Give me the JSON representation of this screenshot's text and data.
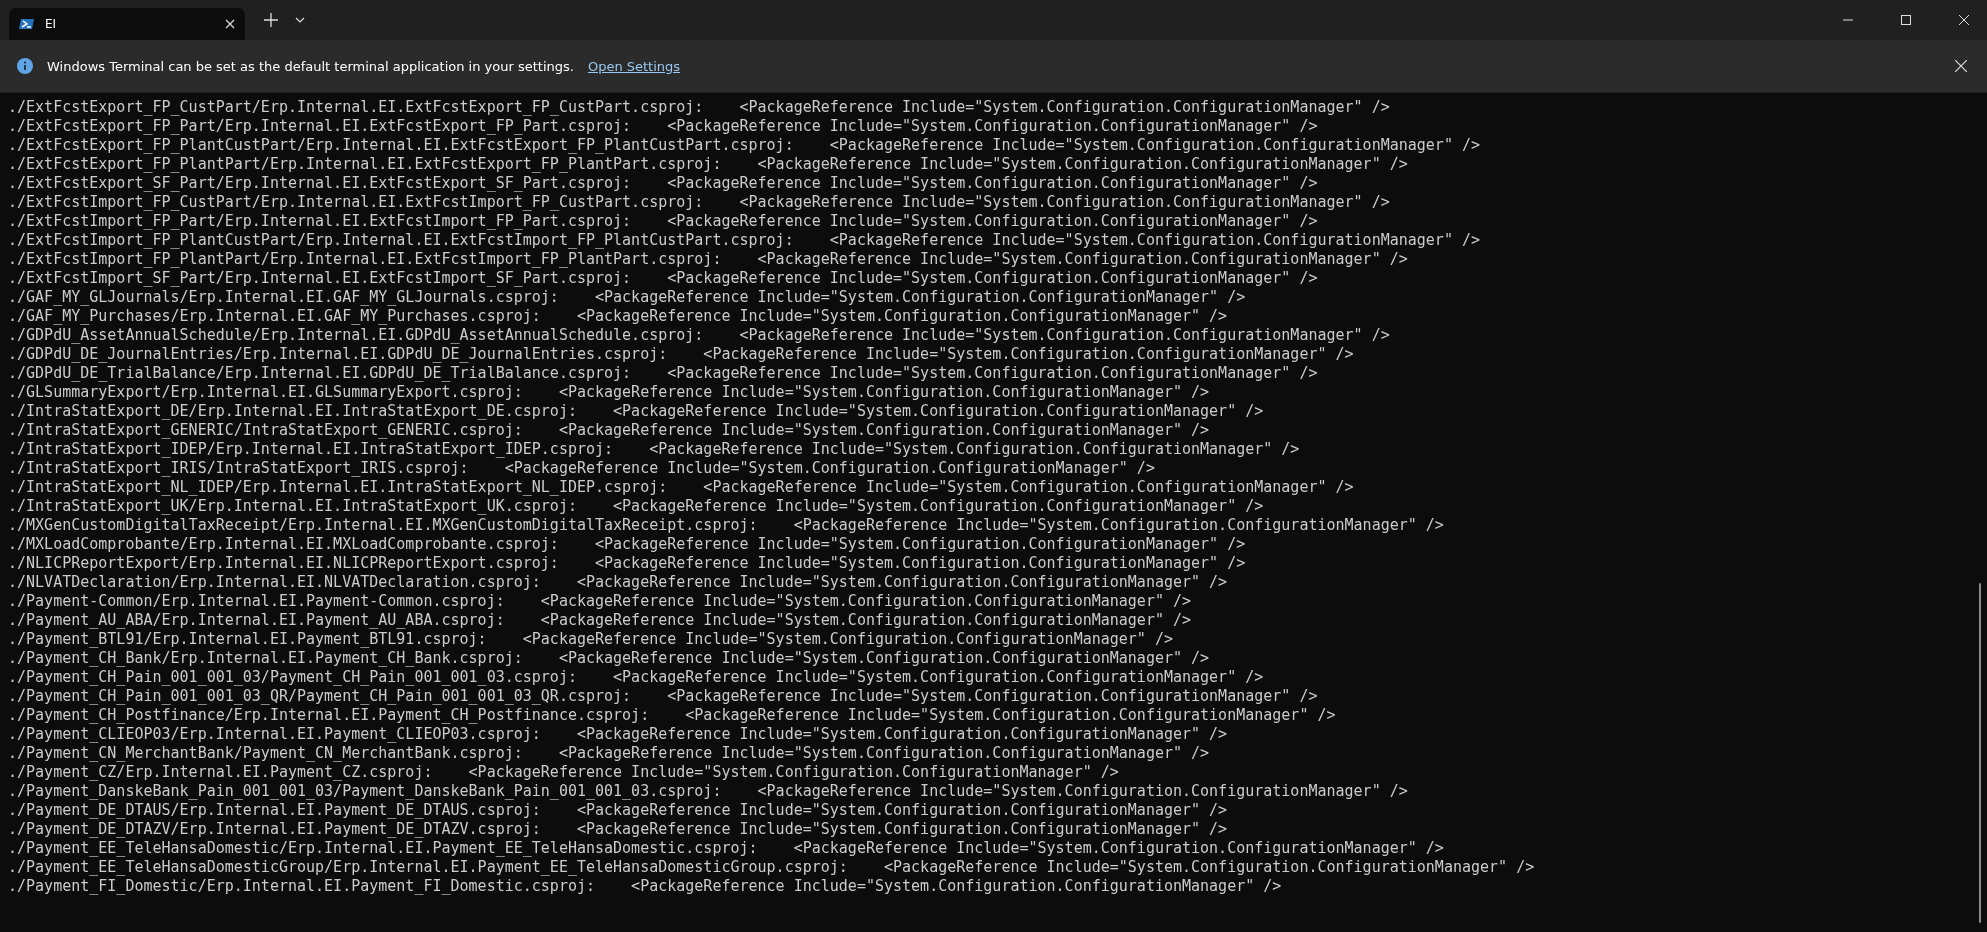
{
  "tab": {
    "title": "EI"
  },
  "infobar": {
    "message": "Windows Terminal can be set as the default terminal application in your settings.",
    "link": "Open Settings"
  },
  "terminal": {
    "lines": [
      "./ExtFcstExport_FP_CustPart/Erp.Internal.EI.ExtFcstExport_FP_CustPart.csproj:    <PackageReference Include=\"System.Configuration.ConfigurationManager\" />",
      "./ExtFcstExport_FP_Part/Erp.Internal.EI.ExtFcstExport_FP_Part.csproj:    <PackageReference Include=\"System.Configuration.ConfigurationManager\" />",
      "./ExtFcstExport_FP_PlantCustPart/Erp.Internal.EI.ExtFcstExport_FP_PlantCustPart.csproj:    <PackageReference Include=\"System.Configuration.ConfigurationManager\" />",
      "./ExtFcstExport_FP_PlantPart/Erp.Internal.EI.ExtFcstExport_FP_PlantPart.csproj:    <PackageReference Include=\"System.Configuration.ConfigurationManager\" />",
      "./ExtFcstExport_SF_Part/Erp.Internal.EI.ExtFcstExport_SF_Part.csproj:    <PackageReference Include=\"System.Configuration.ConfigurationManager\" />",
      "./ExtFcstImport_FP_CustPart/Erp.Internal.EI.ExtFcstImport_FP_CustPart.csproj:    <PackageReference Include=\"System.Configuration.ConfigurationManager\" />",
      "./ExtFcstImport_FP_Part/Erp.Internal.EI.ExtFcstImport_FP_Part.csproj:    <PackageReference Include=\"System.Configuration.ConfigurationManager\" />",
      "./ExtFcstImport_FP_PlantCustPart/Erp.Internal.EI.ExtFcstImport_FP_PlantCustPart.csproj:    <PackageReference Include=\"System.Configuration.ConfigurationManager\" />",
      "./ExtFcstImport_FP_PlantPart/Erp.Internal.EI.ExtFcstImport_FP_PlantPart.csproj:    <PackageReference Include=\"System.Configuration.ConfigurationManager\" />",
      "./ExtFcstImport_SF_Part/Erp.Internal.EI.ExtFcstImport_SF_Part.csproj:    <PackageReference Include=\"System.Configuration.ConfigurationManager\" />",
      "./GAF_MY_GLJournals/Erp.Internal.EI.GAF_MY_GLJournals.csproj:    <PackageReference Include=\"System.Configuration.ConfigurationManager\" />",
      "./GAF_MY_Purchases/Erp.Internal.EI.GAF_MY_Purchases.csproj:    <PackageReference Include=\"System.Configuration.ConfigurationManager\" />",
      "./GDPdU_AssetAnnualSchedule/Erp.Internal.EI.GDPdU_AssetAnnualSchedule.csproj:    <PackageReference Include=\"System.Configuration.ConfigurationManager\" />",
      "./GDPdU_DE_JournalEntries/Erp.Internal.EI.GDPdU_DE_JournalEntries.csproj:    <PackageReference Include=\"System.Configuration.ConfigurationManager\" />",
      "./GDPdU_DE_TrialBalance/Erp.Internal.EI.GDPdU_DE_TrialBalance.csproj:    <PackageReference Include=\"System.Configuration.ConfigurationManager\" />",
      "./GLSummaryExport/Erp.Internal.EI.GLSummaryExport.csproj:    <PackageReference Include=\"System.Configuration.ConfigurationManager\" />",
      "./IntraStatExport_DE/Erp.Internal.EI.IntraStatExport_DE.csproj:    <PackageReference Include=\"System.Configuration.ConfigurationManager\" />",
      "./IntraStatExport_GENERIC/IntraStatExport_GENERIC.csproj:    <PackageReference Include=\"System.Configuration.ConfigurationManager\" />",
      "./IntraStatExport_IDEP/Erp.Internal.EI.IntraStatExport_IDEP.csproj:    <PackageReference Include=\"System.Configuration.ConfigurationManager\" />",
      "./IntraStatExport_IRIS/IntraStatExport_IRIS.csproj:    <PackageReference Include=\"System.Configuration.ConfigurationManager\" />",
      "./IntraStatExport_NL_IDEP/Erp.Internal.EI.IntraStatExport_NL_IDEP.csproj:    <PackageReference Include=\"System.Configuration.ConfigurationManager\" />",
      "./IntraStatExport_UK/Erp.Internal.EI.IntraStatExport_UK.csproj:    <PackageReference Include=\"System.Configuration.ConfigurationManager\" />",
      "./MXGenCustomDigitalTaxReceipt/Erp.Internal.EI.MXGenCustomDigitalTaxReceipt.csproj:    <PackageReference Include=\"System.Configuration.ConfigurationManager\" />",
      "./MXLoadComprobante/Erp.Internal.EI.MXLoadComprobante.csproj:    <PackageReference Include=\"System.Configuration.ConfigurationManager\" />",
      "./NLICPReportExport/Erp.Internal.EI.NLICPReportExport.csproj:    <PackageReference Include=\"System.Configuration.ConfigurationManager\" />",
      "./NLVATDeclaration/Erp.Internal.EI.NLVATDeclaration.csproj:    <PackageReference Include=\"System.Configuration.ConfigurationManager\" />",
      "./Payment-Common/Erp.Internal.EI.Payment-Common.csproj:    <PackageReference Include=\"System.Configuration.ConfigurationManager\" />",
      "./Payment_AU_ABA/Erp.Internal.EI.Payment_AU_ABA.csproj:    <PackageReference Include=\"System.Configuration.ConfigurationManager\" />",
      "./Payment_BTL91/Erp.Internal.EI.Payment_BTL91.csproj:    <PackageReference Include=\"System.Configuration.ConfigurationManager\" />",
      "./Payment_CH_Bank/Erp.Internal.EI.Payment_CH_Bank.csproj:    <PackageReference Include=\"System.Configuration.ConfigurationManager\" />",
      "./Payment_CH_Pain_001_001_03/Payment_CH_Pain_001_001_03.csproj:    <PackageReference Include=\"System.Configuration.ConfigurationManager\" />",
      "./Payment_CH_Pain_001_001_03_QR/Payment_CH_Pain_001_001_03_QR.csproj:    <PackageReference Include=\"System.Configuration.ConfigurationManager\" />",
      "./Payment_CH_Postfinance/Erp.Internal.EI.Payment_CH_Postfinance.csproj:    <PackageReference Include=\"System.Configuration.ConfigurationManager\" />",
      "./Payment_CLIEOP03/Erp.Internal.EI.Payment_CLIEOP03.csproj:    <PackageReference Include=\"System.Configuration.ConfigurationManager\" />",
      "./Payment_CN_MerchantBank/Payment_CN_MerchantBank.csproj:    <PackageReference Include=\"System.Configuration.ConfigurationManager\" />",
      "./Payment_CZ/Erp.Internal.EI.Payment_CZ.csproj:    <PackageReference Include=\"System.Configuration.ConfigurationManager\" />",
      "./Payment_DanskeBank_Pain_001_001_03/Payment_DanskeBank_Pain_001_001_03.csproj:    <PackageReference Include=\"System.Configuration.ConfigurationManager\" />",
      "./Payment_DE_DTAUS/Erp.Internal.EI.Payment_DE_DTAUS.csproj:    <PackageReference Include=\"System.Configuration.ConfigurationManager\" />",
      "./Payment_DE_DTAZV/Erp.Internal.EI.Payment_DE_DTAZV.csproj:    <PackageReference Include=\"System.Configuration.ConfigurationManager\" />",
      "./Payment_EE_TeleHansaDomestic/Erp.Internal.EI.Payment_EE_TeleHansaDomestic.csproj:    <PackageReference Include=\"System.Configuration.ConfigurationManager\" />",
      "./Payment_EE_TeleHansaDomesticGroup/Erp.Internal.EI.Payment_EE_TeleHansaDomesticGroup.csproj:    <PackageReference Include=\"System.Configuration.ConfigurationManager\" />",
      "./Payment_FI_Domestic/Erp.Internal.EI.Payment_FI_Domestic.csproj:    <PackageReference Include=\"System.Configuration.ConfigurationManager\" />"
    ]
  }
}
